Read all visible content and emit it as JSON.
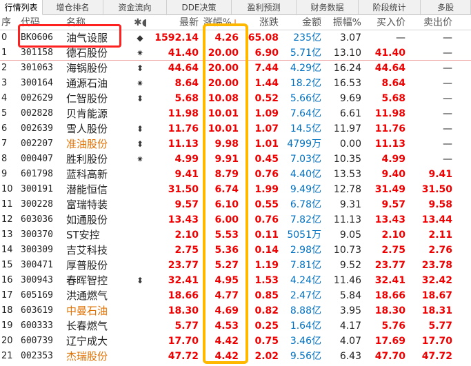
{
  "tabs": [
    {
      "label": "行情列表",
      "width": 62
    },
    {
      "label": "增仓排名",
      "width": 88
    },
    {
      "label": "资金流向",
      "width": 92
    },
    {
      "label": "DDE决策",
      "width": 94
    },
    {
      "label": "盈利预测",
      "width": 94
    },
    {
      "label": "财务数据",
      "width": 90
    },
    {
      "label": "阶段统计",
      "width": 90
    },
    {
      "label": "多股",
      "width": 73
    }
  ],
  "columns": {
    "seq": "序",
    "code": "代码",
    "name": "名称",
    "mark": "✱●",
    "last": "最新",
    "pct": "涨幅%",
    "pct_sort": "↓",
    "chg": "涨跌",
    "amt": "金额",
    "amp": "振幅%",
    "buy": "买入价",
    "sell": "卖出价"
  },
  "colors": {
    "up_red": "#e00000",
    "amount_blue": "#0070c0",
    "name_orange": "#e07000",
    "highlight_red": "#ff2020",
    "highlight_yellow": "#ffb800"
  },
  "rows": [
    {
      "seq": "0",
      "code": "BK0606",
      "name": "油气设服",
      "mark": "◆",
      "last": "1592.14",
      "pct": "4.26",
      "chg": "65.08",
      "amt_num": "235",
      "amt_unit": "亿",
      "amp": "3.07",
      "buy": "—",
      "sell": "—",
      "orange": false
    },
    {
      "seq": "1",
      "code": "301158",
      "name": "德石股份",
      "mark": "✷",
      "last": "41.40",
      "pct": "20.00",
      "chg": "6.90",
      "amt_num": "5.71",
      "amt_unit": "亿",
      "amp": "13.10",
      "buy": "41.40",
      "sell": "—",
      "orange": false
    },
    {
      "seq": "2",
      "code": "301063",
      "name": "海锅股份",
      "mark": "⬍",
      "last": "44.64",
      "pct": "20.00",
      "chg": "7.44",
      "amt_num": "4.29",
      "amt_unit": "亿",
      "amp": "16.24",
      "buy": "44.64",
      "sell": "—",
      "orange": false
    },
    {
      "seq": "3",
      "code": "300164",
      "name": "通源石油",
      "mark": "✷",
      "last": "8.64",
      "pct": "20.00",
      "chg": "1.44",
      "amt_num": "18.2",
      "amt_unit": "亿",
      "amp": "16.53",
      "buy": "8.64",
      "sell": "—",
      "orange": false
    },
    {
      "seq": "4",
      "code": "002629",
      "name": "仁智股份",
      "mark": "⬍",
      "last": "5.68",
      "pct": "10.08",
      "chg": "0.52",
      "amt_num": "5.66",
      "amt_unit": "亿",
      "amp": "9.69",
      "buy": "5.68",
      "sell": "—",
      "orange": false
    },
    {
      "seq": "5",
      "code": "002828",
      "name": "贝肯能源",
      "mark": "",
      "last": "11.98",
      "pct": "10.01",
      "chg": "1.09",
      "amt_num": "7.64",
      "amt_unit": "亿",
      "amp": "6.61",
      "buy": "11.98",
      "sell": "—",
      "orange": false
    },
    {
      "seq": "6",
      "code": "002639",
      "name": "雪人股份",
      "mark": "⬍",
      "last": "11.76",
      "pct": "10.01",
      "chg": "1.07",
      "amt_num": "14.5",
      "amt_unit": "亿",
      "amp": "11.97",
      "buy": "11.76",
      "sell": "—",
      "orange": false
    },
    {
      "seq": "7",
      "code": "002207",
      "name": "准油股份",
      "mark": "⬍",
      "last": "11.13",
      "pct": "9.98",
      "chg": "1.01",
      "amt_num": "4799",
      "amt_unit": "万",
      "amp": "0.00",
      "buy": "11.13",
      "sell": "—",
      "orange": true
    },
    {
      "seq": "8",
      "code": "000407",
      "name": "胜利股份",
      "mark": "✷",
      "last": "4.99",
      "pct": "9.91",
      "chg": "0.45",
      "amt_num": "7.03",
      "amt_unit": "亿",
      "amp": "10.35",
      "buy": "4.99",
      "sell": "—",
      "orange": false
    },
    {
      "seq": "9",
      "code": "601798",
      "name": "蓝科高新",
      "mark": "",
      "last": "9.41",
      "pct": "8.79",
      "chg": "0.76",
      "amt_num": "4.40",
      "amt_unit": "亿",
      "amp": "13.53",
      "buy": "9.40",
      "sell": "9.41",
      "orange": false
    },
    {
      "seq": "10",
      "code": "300191",
      "name": "潜能恒信",
      "mark": "",
      "last": "31.50",
      "pct": "6.74",
      "chg": "1.99",
      "amt_num": "9.49",
      "amt_unit": "亿",
      "amp": "12.78",
      "buy": "31.49",
      "sell": "31.50",
      "orange": false
    },
    {
      "seq": "11",
      "code": "300228",
      "name": "富瑞特装",
      "mark": "",
      "last": "9.57",
      "pct": "6.10",
      "chg": "0.55",
      "amt_num": "6.78",
      "amt_unit": "亿",
      "amp": "9.31",
      "buy": "9.57",
      "sell": "9.58",
      "orange": false
    },
    {
      "seq": "12",
      "code": "603036",
      "name": "如通股份",
      "mark": "",
      "last": "13.43",
      "pct": "6.00",
      "chg": "0.76",
      "amt_num": "7.82",
      "amt_unit": "亿",
      "amp": "11.13",
      "buy": "13.43",
      "sell": "13.44",
      "orange": false
    },
    {
      "seq": "13",
      "code": "300370",
      "name": "ST安控",
      "mark": "",
      "last": "2.10",
      "pct": "5.53",
      "chg": "0.11",
      "amt_num": "5051",
      "amt_unit": "万",
      "amp": "9.05",
      "buy": "2.10",
      "sell": "2.11",
      "orange": false
    },
    {
      "seq": "14",
      "code": "300309",
      "name": "吉艾科技",
      "mark": "",
      "last": "2.75",
      "pct": "5.36",
      "chg": "0.14",
      "amt_num": "2.98",
      "amt_unit": "亿",
      "amp": "10.73",
      "buy": "2.75",
      "sell": "2.76",
      "orange": false
    },
    {
      "seq": "15",
      "code": "300471",
      "name": "厚普股份",
      "mark": "",
      "last": "23.77",
      "pct": "5.27",
      "chg": "1.19",
      "amt_num": "7.81",
      "amt_unit": "亿",
      "amp": "9.52",
      "buy": "23.77",
      "sell": "23.78",
      "orange": false
    },
    {
      "seq": "16",
      "code": "300943",
      "name": "春晖智控",
      "mark": "⬍",
      "last": "32.41",
      "pct": "4.95",
      "chg": "1.53",
      "amt_num": "4.24",
      "amt_unit": "亿",
      "amp": "11.46",
      "buy": "32.41",
      "sell": "32.42",
      "orange": false
    },
    {
      "seq": "17",
      "code": "605169",
      "name": "洪通燃气",
      "mark": "",
      "last": "18.66",
      "pct": "4.77",
      "chg": "0.85",
      "amt_num": "2.47",
      "amt_unit": "亿",
      "amp": "5.84",
      "buy": "18.66",
      "sell": "18.67",
      "orange": false
    },
    {
      "seq": "18",
      "code": "603619",
      "name": "中曼石油",
      "mark": "",
      "last": "18.30",
      "pct": "4.69",
      "chg": "0.82",
      "amt_num": "8.88",
      "amt_unit": "亿",
      "amp": "3.95",
      "buy": "18.30",
      "sell": "18.31",
      "orange": true
    },
    {
      "seq": "19",
      "code": "600333",
      "name": "长春燃气",
      "mark": "",
      "last": "5.77",
      "pct": "4.53",
      "chg": "0.25",
      "amt_num": "1.64",
      "amt_unit": "亿",
      "amp": "4.17",
      "buy": "5.76",
      "sell": "5.77",
      "orange": false
    },
    {
      "seq": "20",
      "code": "600739",
      "name": "辽宁成大",
      "mark": "",
      "last": "17.70",
      "pct": "4.42",
      "chg": "0.75",
      "amt_num": "3.46",
      "amt_unit": "亿",
      "amp": "4.07",
      "buy": "17.69",
      "sell": "17.70",
      "orange": false
    },
    {
      "seq": "21",
      "code": "002353",
      "name": "杰瑞股份",
      "mark": "",
      "last": "47.72",
      "pct": "4.42",
      "chg": "2.02",
      "amt_num": "9.56",
      "amt_unit": "亿",
      "amp": "6.43",
      "buy": "47.70",
      "sell": "47.72",
      "orange": true
    }
  ]
}
